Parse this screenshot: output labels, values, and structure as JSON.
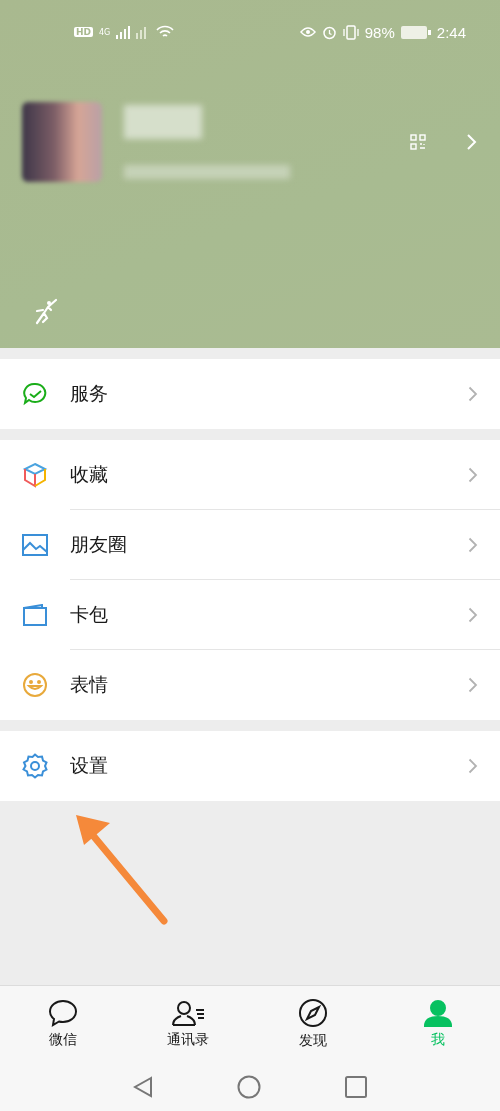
{
  "status_bar": {
    "hd": "HD",
    "network": "4G",
    "battery": "98%",
    "time": "2:44"
  },
  "menu_groups": [
    [
      {
        "kind": "service",
        "label": "服务"
      }
    ],
    [
      {
        "kind": "favorites",
        "label": "收藏"
      },
      {
        "kind": "moments",
        "label": "朋友圈"
      },
      {
        "kind": "cards",
        "label": "卡包"
      },
      {
        "kind": "stickers",
        "label": "表情"
      }
    ],
    [
      {
        "kind": "settings",
        "label": "设置"
      }
    ]
  ],
  "tabs": [
    {
      "kind": "chats",
      "label": "微信",
      "selected": false
    },
    {
      "kind": "contacts",
      "label": "通讯录",
      "selected": false
    },
    {
      "kind": "discover",
      "label": "发现",
      "selected": false
    },
    {
      "kind": "me",
      "label": "我",
      "selected": true
    }
  ]
}
